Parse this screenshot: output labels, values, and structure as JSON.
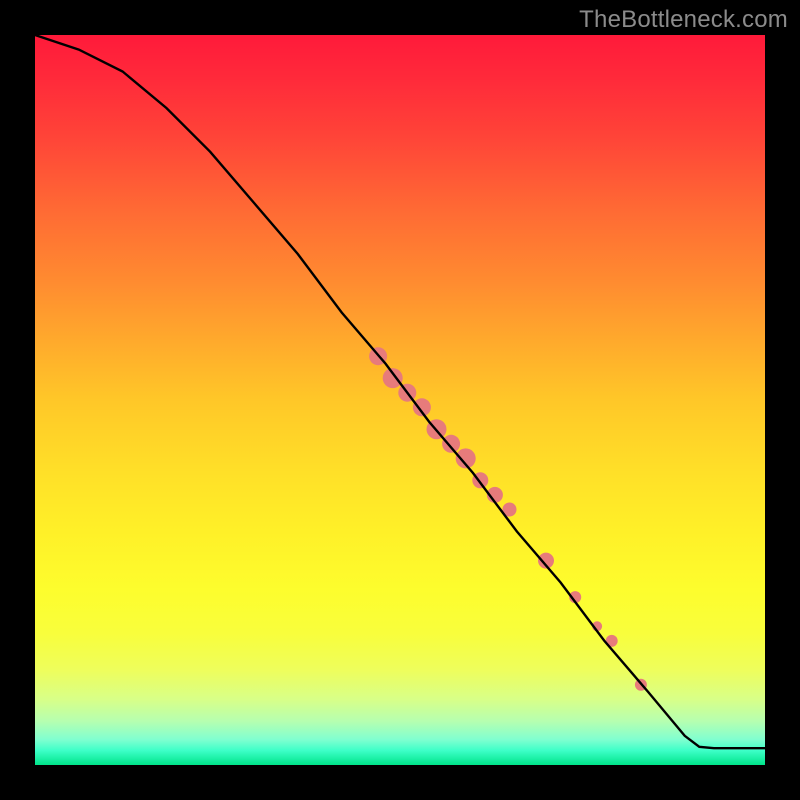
{
  "watermark_text": "TheBottleneck.com",
  "chart_data": {
    "type": "line",
    "title": "",
    "xlabel": "",
    "ylabel": "",
    "xlim": [
      0,
      100
    ],
    "ylim": [
      0,
      100
    ],
    "grid": false,
    "curve": [
      {
        "x": 0,
        "y": 100
      },
      {
        "x": 6,
        "y": 98
      },
      {
        "x": 12,
        "y": 95
      },
      {
        "x": 18,
        "y": 90
      },
      {
        "x": 24,
        "y": 84
      },
      {
        "x": 30,
        "y": 77
      },
      {
        "x": 36,
        "y": 70
      },
      {
        "x": 42,
        "y": 62
      },
      {
        "x": 48,
        "y": 55
      },
      {
        "x": 54,
        "y": 47
      },
      {
        "x": 60,
        "y": 40
      },
      {
        "x": 66,
        "y": 32
      },
      {
        "x": 72,
        "y": 25
      },
      {
        "x": 78,
        "y": 17
      },
      {
        "x": 84,
        "y": 10
      },
      {
        "x": 89,
        "y": 4
      },
      {
        "x": 91,
        "y": 2.5
      },
      {
        "x": 93,
        "y": 2.3
      },
      {
        "x": 100,
        "y": 2.3
      }
    ],
    "markers": [
      {
        "x": 47,
        "y": 56,
        "r": 9
      },
      {
        "x": 49,
        "y": 53,
        "r": 10
      },
      {
        "x": 51,
        "y": 51,
        "r": 9
      },
      {
        "x": 53,
        "y": 49,
        "r": 9
      },
      {
        "x": 55,
        "y": 46,
        "r": 10
      },
      {
        "x": 57,
        "y": 44,
        "r": 9
      },
      {
        "x": 59,
        "y": 42,
        "r": 10
      },
      {
        "x": 61,
        "y": 39,
        "r": 8
      },
      {
        "x": 63,
        "y": 37,
        "r": 8
      },
      {
        "x": 65,
        "y": 35,
        "r": 7
      },
      {
        "x": 70,
        "y": 28,
        "r": 8
      },
      {
        "x": 74,
        "y": 23,
        "r": 6
      },
      {
        "x": 77,
        "y": 19,
        "r": 5
      },
      {
        "x": 79,
        "y": 17,
        "r": 6
      },
      {
        "x": 83,
        "y": 11,
        "r": 6
      }
    ],
    "curve_color": "#000000",
    "marker_color": "#e77b7b"
  }
}
